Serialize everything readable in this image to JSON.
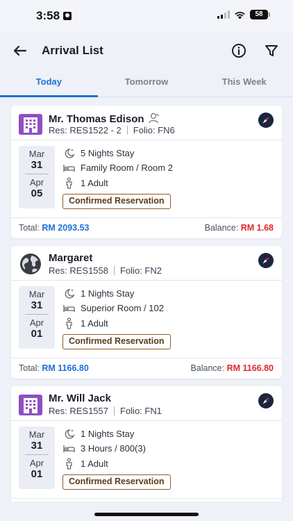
{
  "status_bar": {
    "time": "3:58",
    "battery": "58"
  },
  "header": {
    "title": "Arrival List"
  },
  "tabs": [
    {
      "label": "Today",
      "active": true
    },
    {
      "label": "Tomorrow",
      "active": false
    },
    {
      "label": "This Week",
      "active": false
    }
  ],
  "reservations": [
    {
      "guest_name": "Mr. Thomas Edison",
      "guest_icon": "hotel-icon",
      "res_label": "Res: RES1522 - 2",
      "folio_label": "Folio: FN6",
      "arrival_month": "Mar",
      "arrival_day": "31",
      "departure_month": "Apr",
      "departure_day": "05",
      "nights": "5 Nights Stay",
      "room": "Family Room / Room 2",
      "guests": "1 Adult",
      "status": "Confirmed Reservation",
      "total_label": "Total:",
      "total_value": "RM 2093.53",
      "balance_label": "Balance:",
      "balance_value": "RM 1.68"
    },
    {
      "guest_name": "Margaret",
      "guest_icon": "globe-icon",
      "res_label": "Res: RES1558",
      "folio_label": "Folio: FN2",
      "arrival_month": "Mar",
      "arrival_day": "31",
      "departure_month": "Apr",
      "departure_day": "01",
      "nights": "1 Nights Stay",
      "room": "Superior Room / 102",
      "guests": "1 Adult",
      "status": "Confirmed Reservation",
      "total_label": "Total:",
      "total_value": "RM 1166.80",
      "balance_label": "Balance:",
      "balance_value": "RM 1166.80"
    },
    {
      "guest_name": "Mr. Will Jack",
      "guest_icon": "hotel-icon",
      "res_label": "Res: RES1557",
      "folio_label": "Folio: FN1",
      "arrival_month": "Mar",
      "arrival_day": "31",
      "departure_month": "Apr",
      "departure_day": "01",
      "nights": "1 Nights Stay",
      "room": "3 Hours / 800(3)",
      "guests": "1 Adult",
      "status": "Confirmed Reservation",
      "total_label": "",
      "total_value": "",
      "balance_label": "",
      "balance_value": ""
    }
  ],
  "colors": {
    "accent": "#1d6fd8",
    "balance": "#e0262b",
    "hotel_icon": "#8e4fc4",
    "badge_border": "#8a5a2b"
  }
}
